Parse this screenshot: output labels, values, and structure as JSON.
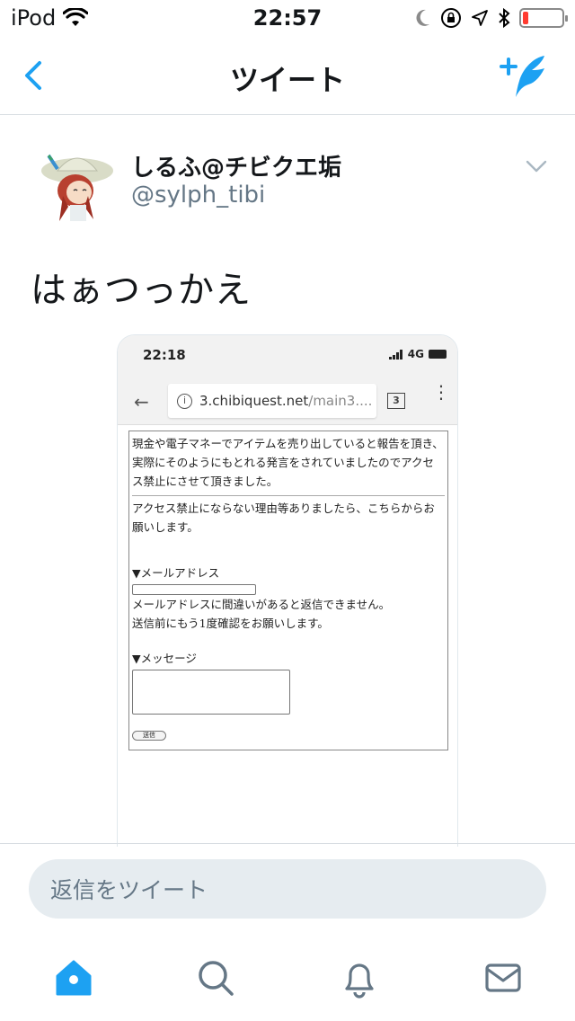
{
  "status_bar": {
    "carrier": "iPod",
    "time": "22:57",
    "battery_level": 0.15,
    "icons": [
      "wifi-icon",
      "moon-icon",
      "orientation-lock-icon",
      "location-icon",
      "bluetooth-icon",
      "battery-icon"
    ]
  },
  "nav": {
    "title": "ツイート",
    "back_icon": "chevron-left-icon",
    "compose_icon": "compose-tweet-icon"
  },
  "tweet": {
    "display_name": "しるふ@チビクエ垢",
    "username": "@sylph_tibi",
    "text": "はぁつっかえ",
    "menu_icon": "chevron-down-icon"
  },
  "media": {
    "status_time": "22:18",
    "network": "4G",
    "url_domain": "3.chibiquest.net",
    "url_rest": "/main3....",
    "tab_count": "3",
    "page": {
      "paragraph1": "現金や電子マネーでアイテムを売り出していると報告を頂き、実際にそのようにもとれる発言をされていましたのでアクセス禁止にさせて頂きました。",
      "paragraph2": "アクセス禁止にならない理由等ありましたら、こちらからお願いします。",
      "email_label": "▼メールアドレス",
      "email_note1": "メールアドレスに間違いがあると返信できません。",
      "email_note2": "送信前にもう1度確認をお願いします。",
      "message_label": "▼メッセージ",
      "send_button": "送信"
    }
  },
  "reply": {
    "placeholder": "返信をツイート"
  },
  "tab_bar": {
    "items": [
      "home-icon",
      "search-icon",
      "notifications-icon",
      "messages-icon"
    ],
    "active": "home-icon"
  },
  "colors": {
    "accent": "#1da1f2",
    "secondary_text": "#657786",
    "reply_bg": "#e6ecf0",
    "battery_low": "#ff3b30"
  }
}
